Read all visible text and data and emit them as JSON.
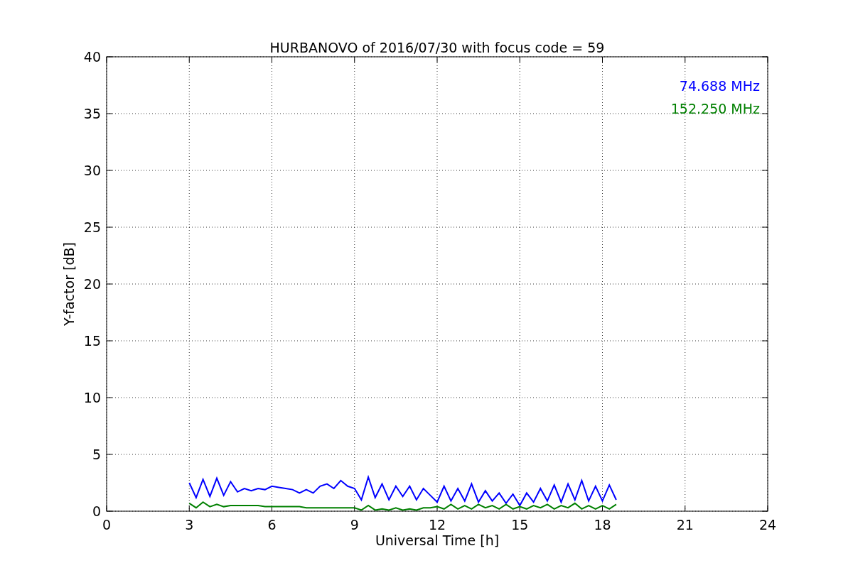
{
  "figure": {
    "chart_data": {
      "type": "line",
      "title": "HURBANOVO of 2016/07/30 with focus code = 59",
      "xlabel": "Universal Time [h]",
      "ylabel": "Y-factor [dB]",
      "x": [
        3,
        3.25,
        3.5,
        3.75,
        4,
        4.25,
        4.5,
        4.75,
        5,
        5.25,
        5.5,
        5.75,
        6,
        6.25,
        6.5,
        6.75,
        7,
        7.25,
        7.5,
        7.75,
        8,
        8.25,
        8.5,
        8.75,
        9,
        9.25,
        9.5,
        9.75,
        10,
        10.25,
        10.5,
        10.75,
        11,
        11.25,
        11.5,
        11.75,
        12,
        12.25,
        12.5,
        12.75,
        13,
        13.25,
        13.5,
        13.75,
        14,
        14.25,
        14.5,
        14.75,
        15,
        15.25,
        15.5,
        15.75,
        16,
        16.25,
        16.5,
        16.75,
        17,
        17.25,
        17.5,
        17.75,
        18,
        18.25,
        18.5
      ],
      "series": [
        {
          "name": "74.688 MHz",
          "color": "#0000ff",
          "values": [
            2.5,
            1.2,
            2.8,
            1.3,
            2.9,
            1.4,
            2.6,
            1.7,
            2.0,
            1.8,
            2.0,
            1.9,
            2.2,
            2.1,
            2.0,
            1.9,
            1.6,
            1.9,
            1.6,
            2.2,
            2.4,
            2.0,
            2.7,
            2.2,
            2.0,
            1.0,
            3.0,
            1.2,
            2.4,
            1.0,
            2.2,
            1.3,
            2.2,
            1.0,
            2.0,
            1.4,
            0.8,
            2.2,
            0.9,
            2.0,
            0.9,
            2.4,
            0.8,
            1.8,
            0.9,
            1.6,
            0.7,
            1.5,
            0.5,
            1.6,
            0.8,
            2.0,
            0.9,
            2.3,
            0.8,
            2.4,
            1.0,
            2.7,
            0.9,
            2.2,
            0.9,
            2.3,
            1.0
          ]
        },
        {
          "name": "152.250 MHz",
          "color": "#008000",
          "values": [
            0.7,
            0.3,
            0.8,
            0.4,
            0.6,
            0.4,
            0.5,
            0.5,
            0.5,
            0.5,
            0.5,
            0.4,
            0.4,
            0.4,
            0.4,
            0.4,
            0.4,
            0.3,
            0.3,
            0.3,
            0.3,
            0.3,
            0.3,
            0.3,
            0.3,
            0.1,
            0.5,
            0.1,
            0.2,
            0.1,
            0.3,
            0.1,
            0.2,
            0.1,
            0.3,
            0.3,
            0.4,
            0.2,
            0.6,
            0.2,
            0.5,
            0.2,
            0.6,
            0.3,
            0.5,
            0.2,
            0.6,
            0.2,
            0.4,
            0.2,
            0.5,
            0.3,
            0.6,
            0.2,
            0.5,
            0.3,
            0.7,
            0.2,
            0.5,
            0.2,
            0.5,
            0.2,
            0.6
          ]
        }
      ],
      "xlim": [
        0,
        24
      ],
      "ylim": [
        0,
        40
      ],
      "xticks": [
        0,
        3,
        6,
        9,
        12,
        15,
        18,
        21,
        24
      ],
      "yticks": [
        0,
        5,
        10,
        15,
        20,
        25,
        30,
        35,
        40
      ],
      "grid": true
    }
  }
}
